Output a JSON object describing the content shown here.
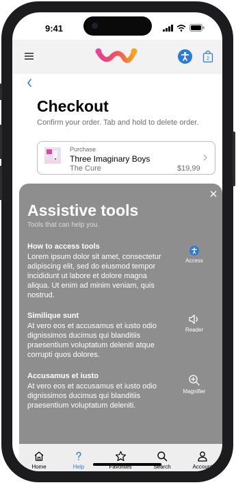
{
  "status_bar": {
    "time": "9:41"
  },
  "header": {
    "menu": "menu-icon",
    "logo": "app-logo",
    "accessibility": "accessibility-icon",
    "cart_count": "2"
  },
  "checkout": {
    "title": "Checkout",
    "subtitle": "Confirm your order. Tab and hold to delete order.",
    "order": {
      "label": "Purchase",
      "title": "Three Imaginary Boys",
      "artist": "The Cure",
      "price": "$19,99"
    }
  },
  "assistive": {
    "title": "Assistive tools",
    "subtitle": "Tools that can help you.",
    "sections": [
      {
        "title": "How to access tools",
        "body": "Lorem ipsum dolor sit amet, consectetur adipiscing elit, sed do eiusmod tempor incididunt ut labore et dolore magna aliqua. Ut enim ad minim veniam, quis nostrud.",
        "tool_label": "Access",
        "tool_icon": "accessibility-icon"
      },
      {
        "title": "Similique sunt",
        "body": "At vero eos et accusamus et iusto odio dignissimos ducimus qui blanditiis praesentium voluptatum deleniti atque corrupti quos dolores.",
        "tool_label": "Reader",
        "tool_icon": "speaker-icon"
      },
      {
        "title": "Accusamus et iusto",
        "body": "At vero eos et accusamus et iusto odio dignissimos ducimus qui blanditiis praesentium voluptatum deleniti.",
        "tool_label": "Magnifier",
        "tool_icon": "zoom-in-icon"
      }
    ]
  },
  "tabs": [
    {
      "label": "Home",
      "icon": "home-icon"
    },
    {
      "label": "Help",
      "icon": "help-icon",
      "active": true
    },
    {
      "label": "Favorites",
      "icon": "star-icon"
    },
    {
      "label": "Search",
      "icon": "search-icon"
    },
    {
      "label": "Account",
      "icon": "person-icon"
    }
  ],
  "colors": {
    "accent": "#2a7bd6",
    "sheet": "#8e8e8e",
    "tabbar": "#eeeeee"
  }
}
